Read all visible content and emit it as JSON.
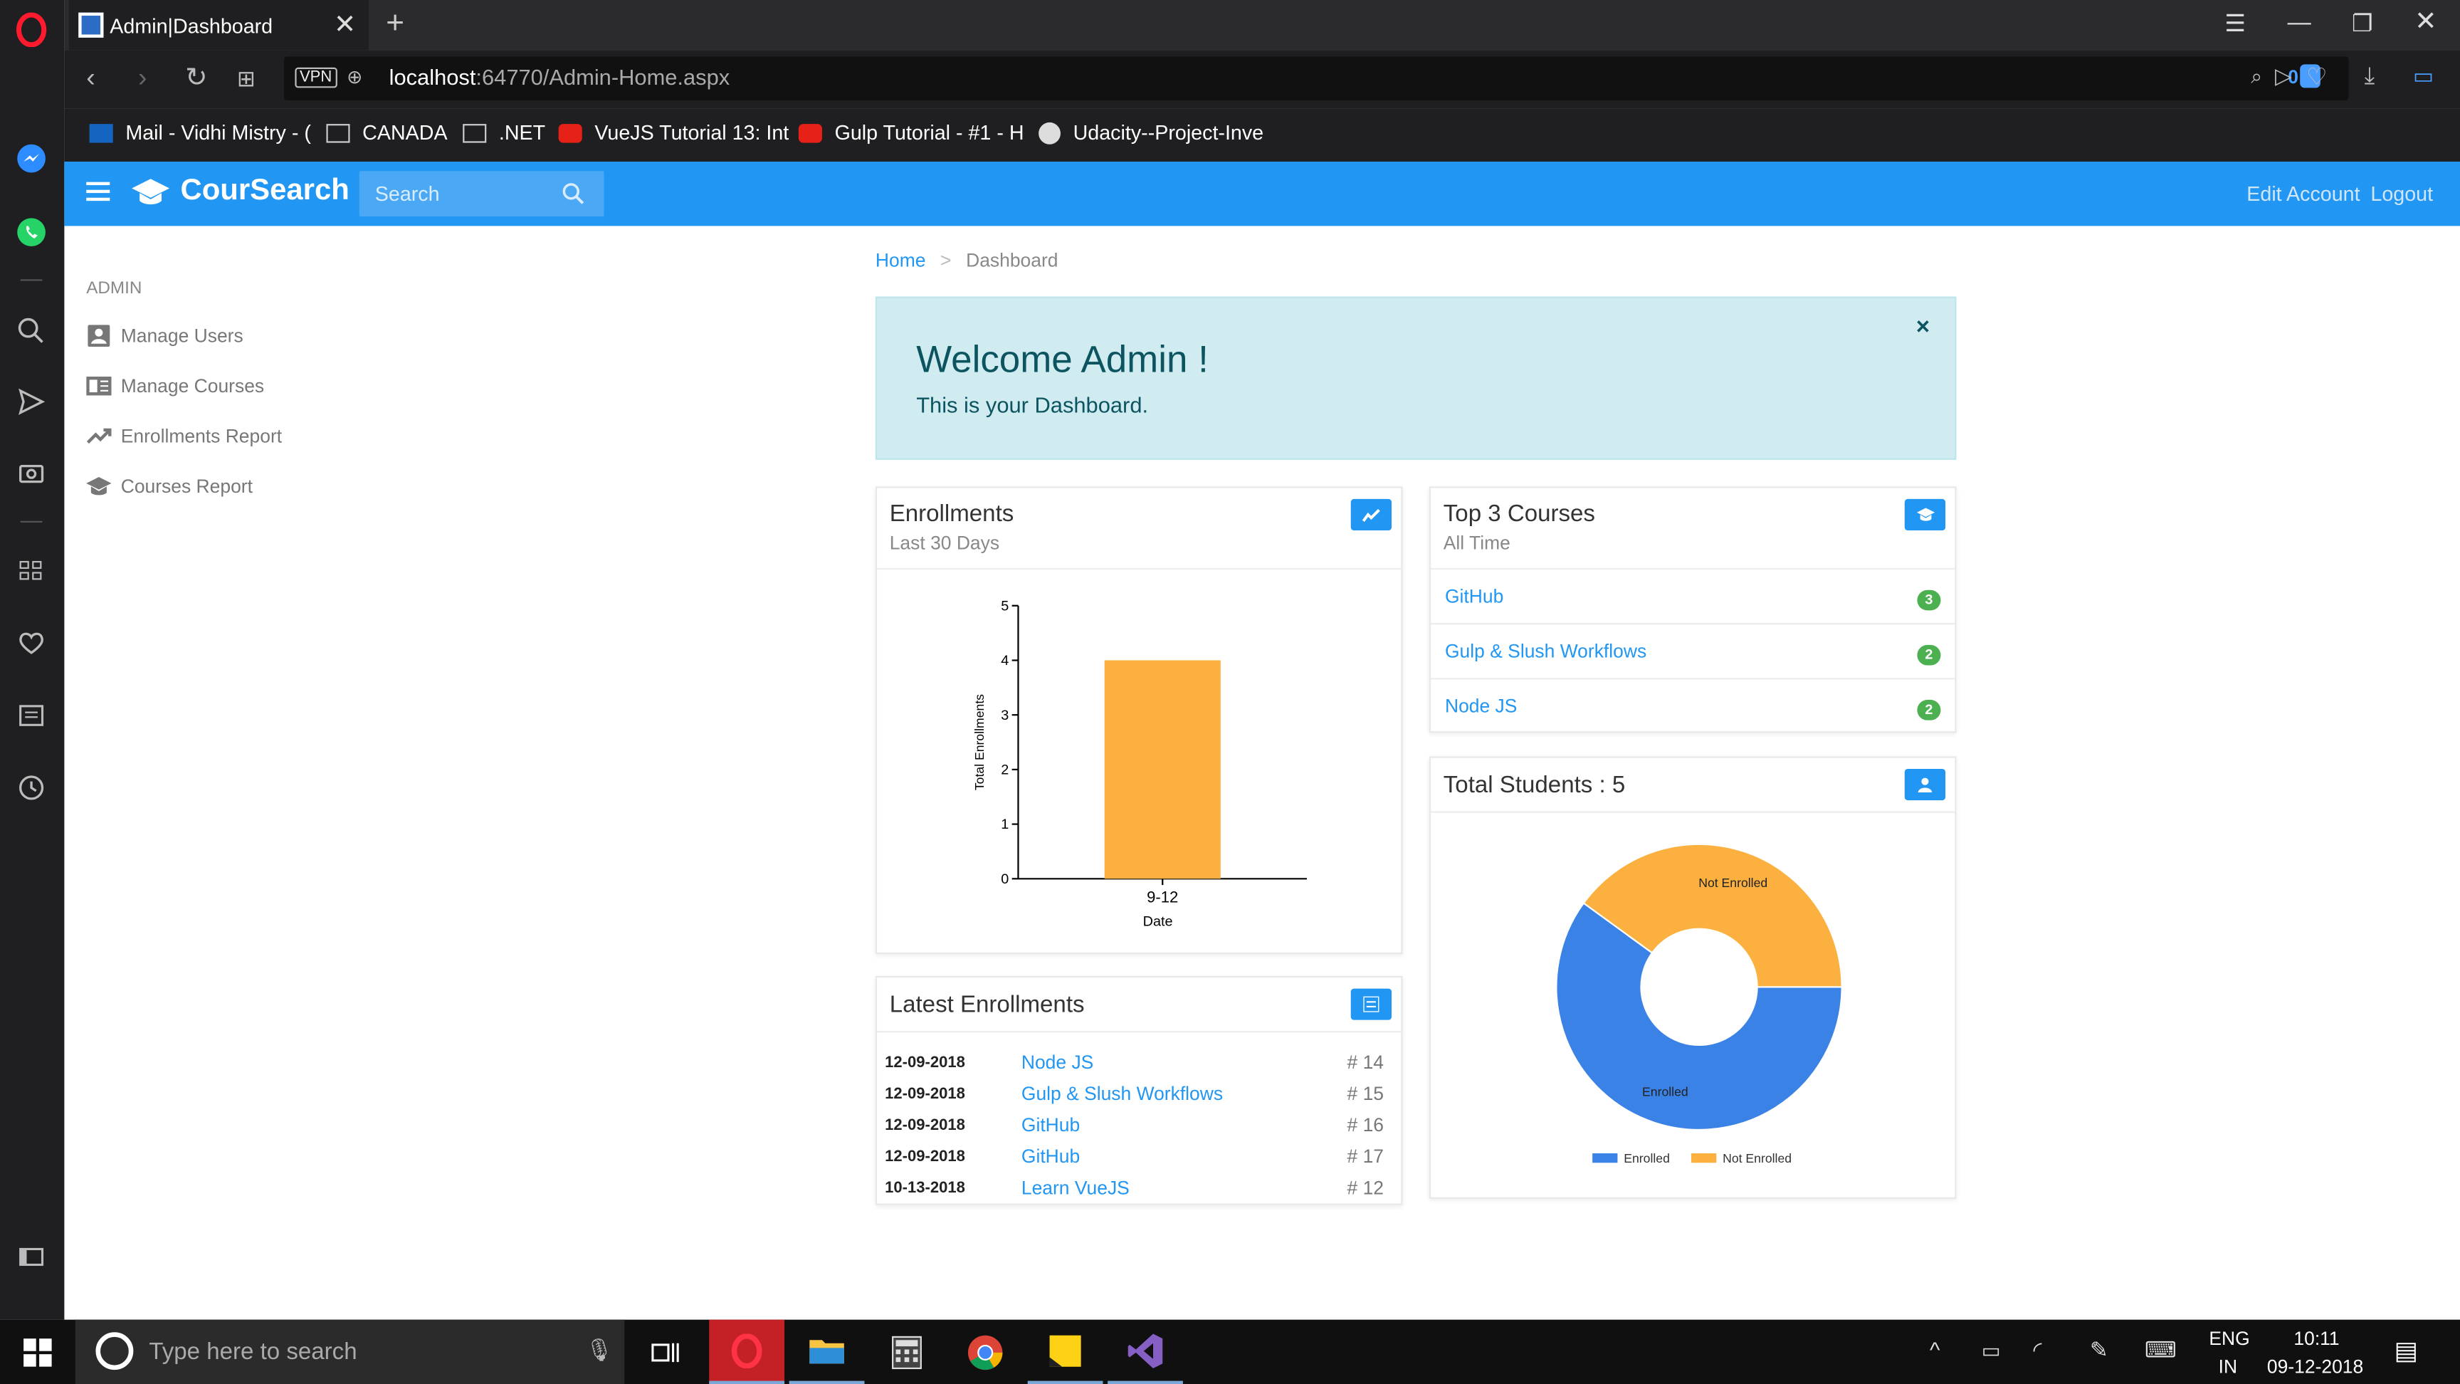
{
  "browser": {
    "tab_title": "Admin|Dashboard",
    "url_host": "localhost",
    "url_path": ":64770/Admin-Home.aspx",
    "vpn_label": "VPN",
    "adblock_count": "0",
    "bookmarks": [
      {
        "label": "Mail - Vidhi Mistry - (",
        "icon": "outlook-icon"
      },
      {
        "label": "CANADA",
        "icon": "folder-icon"
      },
      {
        "label": ".NET",
        "icon": "folder-icon"
      },
      {
        "label": "VueJS Tutorial 13: Int",
        "icon": "youtube-icon"
      },
      {
        "label": "Gulp Tutorial - #1 - H",
        "icon": "youtube-icon"
      },
      {
        "label": "Udacity--Project-Inve",
        "icon": "github-icon"
      }
    ]
  },
  "app": {
    "brand": "CourSearch",
    "search_placeholder": "Search",
    "edit_account": "Edit Account",
    "logout": "Logout",
    "accent": "#2196f3"
  },
  "sidebar": {
    "section": "ADMIN",
    "items": [
      {
        "label": "Manage Users",
        "icon": "user-icon"
      },
      {
        "label": "Manage Courses",
        "icon": "book-icon"
      },
      {
        "label": "Enrollments Report",
        "icon": "trending-icon"
      },
      {
        "label": "Courses Report",
        "icon": "graduation-cap-icon"
      }
    ]
  },
  "breadcrumb": {
    "home": "Home",
    "current": "Dashboard"
  },
  "welcome": {
    "title": "Welcome Admin !",
    "subtitle": "This is your Dashboard.",
    "close": "×"
  },
  "enrollments_card": {
    "title": "Enrollments",
    "subtitle": "Last 30 Days"
  },
  "top_courses_card": {
    "title": "Top 3 Courses",
    "subtitle": "All Time",
    "courses": [
      {
        "name": "GitHub",
        "count": "3"
      },
      {
        "name": "Gulp & Slush Workflows",
        "count": "2"
      },
      {
        "name": "Node JS",
        "count": "2"
      }
    ]
  },
  "latest_card": {
    "title": "Latest Enrollments",
    "rows": [
      {
        "date": "12-09-2018",
        "course": "Node JS",
        "id": "# 14"
      },
      {
        "date": "12-09-2018",
        "course": "Gulp & Slush Workflows",
        "id": "# 15"
      },
      {
        "date": "12-09-2018",
        "course": "GitHub",
        "id": "# 16"
      },
      {
        "date": "12-09-2018",
        "course": "GitHub",
        "id": "# 17"
      },
      {
        "date": "10-13-2018",
        "course": "Learn VueJS",
        "id": "# 12"
      }
    ]
  },
  "students_card": {
    "title": "Total Students : 5"
  },
  "chart_data": [
    {
      "type": "bar",
      "categories": [
        "9-12"
      ],
      "values": [
        4
      ],
      "xlabel": "Date",
      "ylabel": "Total Enrollments",
      "ylim": [
        0,
        5
      ],
      "yticks": [
        "0",
        "1",
        "2",
        "3",
        "4",
        "5"
      ],
      "color": "#fbb040"
    },
    {
      "type": "pie",
      "donut": true,
      "labels": [
        "Enrolled",
        "Not Enrolled"
      ],
      "values": [
        3,
        2
      ],
      "colors": [
        "#3b82e6",
        "#fbb040"
      ],
      "legend": "bottom"
    }
  ],
  "taskbar": {
    "search_placeholder": "Type here to search",
    "lang": "ENG",
    "region": "IN",
    "time": "10:11",
    "date": "09-12-2018"
  }
}
